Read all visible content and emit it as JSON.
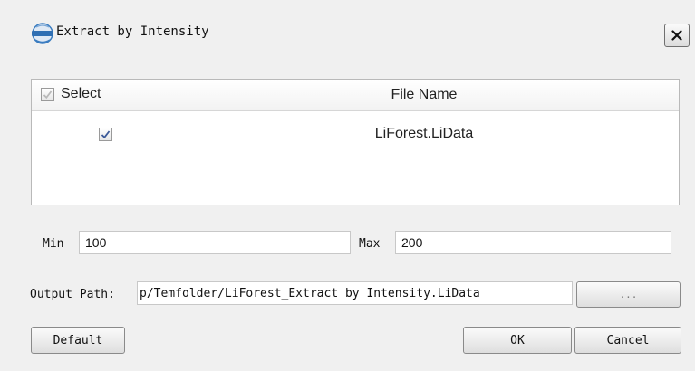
{
  "window": {
    "title": "Extract by Intensity",
    "app_icon": "lidar-app-icon",
    "close_icon": "close-icon"
  },
  "table": {
    "columns": [
      "Select",
      "File Name"
    ],
    "rows": [
      {
        "checked": true,
        "file_name": "LiForest.LiData"
      }
    ]
  },
  "form": {
    "min_label": "Min",
    "min_value": "100",
    "max_label": "Max",
    "max_value": "200",
    "output_label": "Output Path:",
    "output_value": "p/Temfolder/LiForest_Extract by Intensity.LiData",
    "browse_label": "..."
  },
  "buttons": {
    "default": "Default",
    "ok": "OK",
    "cancel": "Cancel"
  }
}
